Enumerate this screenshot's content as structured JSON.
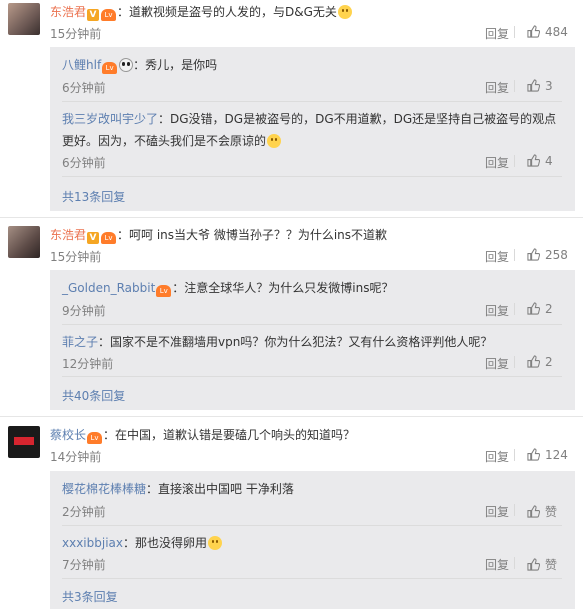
{
  "threads": [
    {
      "user": "东浩君",
      "text": "：道歉视频是盗号的人发的，与D&G无关",
      "time": "15分钟前",
      "reply_label": "回复",
      "likes": "484",
      "replies": [
        {
          "user": "八鲤hlf",
          "text": "：秀儿，是你吗",
          "time": "6分钟前",
          "reply_label": "回复",
          "likes": "3"
        },
        {
          "user": "我三岁改叫宇少了",
          "text": "：DG没错，DG是被盗号的，DG不用道歉，DG还是坚持自己被盗号的观点",
          "text2": "更好。因为，不磕头我们是不会原谅的",
          "time": "6分钟前",
          "reply_label": "回复",
          "likes": "4"
        }
      ],
      "more": "共13条回复"
    },
    {
      "user": "东浩君",
      "text": "：呵呵 ins当大爷 微博当孙子？？为什么ins不道歉",
      "time": "15分钟前",
      "reply_label": "回复",
      "likes": "258",
      "replies": [
        {
          "user": "_Golden_Rabbit",
          "text": "：注意全球华人？为什么只发微博ins呢？",
          "time": "9分钟前",
          "reply_label": "回复",
          "likes": "2"
        },
        {
          "user": "菲之子",
          "text": "：国家不是不准翻墙用vpn吗？你为什么犯法？又有什么资格评判他人呢？",
          "time": "12分钟前",
          "reply_label": "回复",
          "likes": "2"
        }
      ],
      "more": "共40条回复"
    },
    {
      "user": "蔡校长",
      "text": "：在中国，道歉认错是要磕几个响头的知道吗？",
      "time": "14分钟前",
      "reply_label": "回复",
      "likes": "124",
      "replies": [
        {
          "user": "樱花棉花棒棒糖",
          "text": "：直接滚出中国吧 干净利落",
          "time": "2分钟前",
          "reply_label": "回复",
          "likes": "赞"
        },
        {
          "user": "xxxibbjiax",
          "text": "：那也没得卵用",
          "time": "7分钟前",
          "reply_label": "回复",
          "likes": "赞"
        }
      ],
      "more": "共3条回复"
    }
  ],
  "badges": {
    "verified": "V",
    "level": "Lv"
  },
  "colors": {
    "username": "#eb7350",
    "link": "#5d7fb0",
    "muted": "#808080",
    "reply_bg": "#eaeaec"
  }
}
